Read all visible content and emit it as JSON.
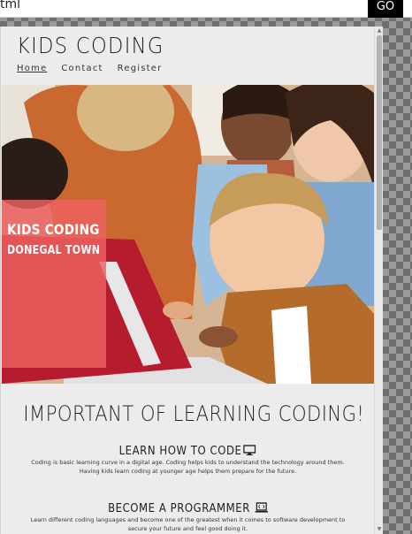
{
  "editor": {
    "url_value": "tml",
    "go_label": "GO"
  },
  "site": {
    "title": "KIDS CODING",
    "nav": [
      {
        "label": "Home"
      },
      {
        "label": "Contact"
      },
      {
        "label": "Register"
      }
    ]
  },
  "hero": {
    "badge_title": "KIDS CODING",
    "badge_subtitle": "DONEGAL TOWN"
  },
  "section": {
    "heading": "IMPORTANT OF LEARNING CODING!",
    "features": [
      {
        "title": "LEARN HOW TO CODE",
        "icon": "desktop-icon",
        "text": "Coding is basic learning curve in a digital age. Coding helps kids to understand the technology around them. Having kids learn coding at younger age helps them prepare for the future."
      },
      {
        "title": "BECOME A PROGRAMMER",
        "icon": "laptop-code-icon",
        "text": "Learn different coding languages and become one of the greatest when it comes to software development to secure your future and feel good doing it."
      }
    ]
  },
  "colors": {
    "badge": "#ee6262",
    "go_button": "#000000",
    "page_bg": "#ececec"
  }
}
